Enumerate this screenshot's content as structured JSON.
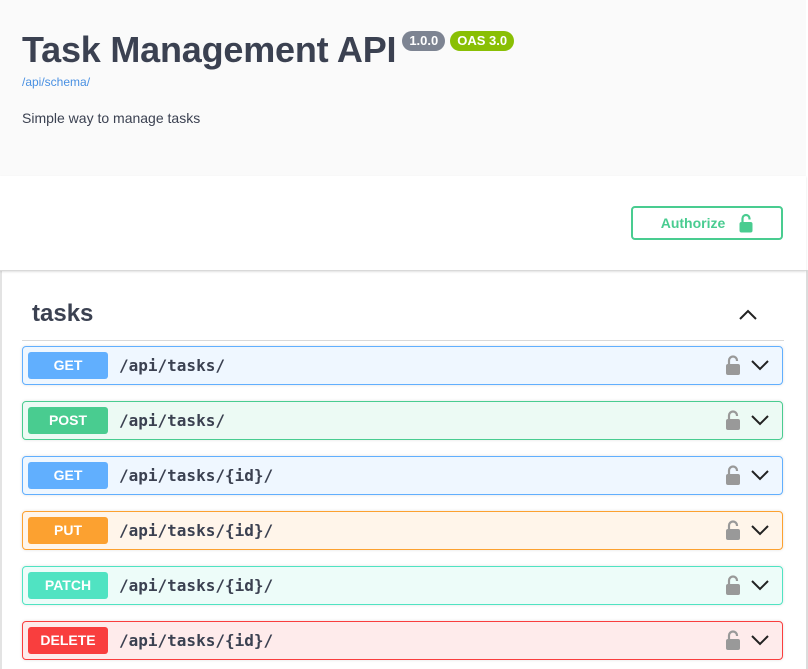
{
  "info": {
    "title": "Task Management API",
    "version_badge": "1.0.0",
    "oas_badge": "OAS 3.0",
    "schema_link": "/api/schema/",
    "description": "Simple way to manage tasks"
  },
  "authorize": {
    "label": "Authorize",
    "icon": "unlock-icon"
  },
  "tag": {
    "name": "tasks",
    "toggle_icon": "chevron-up-icon",
    "operations": [
      {
        "method": "GET",
        "path": "/api/tasks/"
      },
      {
        "method": "POST",
        "path": "/api/tasks/"
      },
      {
        "method": "GET",
        "path": "/api/tasks/{id}/"
      },
      {
        "method": "PUT",
        "path": "/api/tasks/{id}/"
      },
      {
        "method": "PATCH",
        "path": "/api/tasks/{id}/"
      },
      {
        "method": "DELETE",
        "path": "/api/tasks/{id}/"
      }
    ]
  },
  "colors": {
    "get": "#61affe",
    "post": "#49cc90",
    "put": "#fca130",
    "patch": "#50e3c2",
    "delete": "#f93e3e",
    "version_badge": "#7d8492",
    "oas_badge": "#89bf04",
    "link": "#4990e2"
  }
}
